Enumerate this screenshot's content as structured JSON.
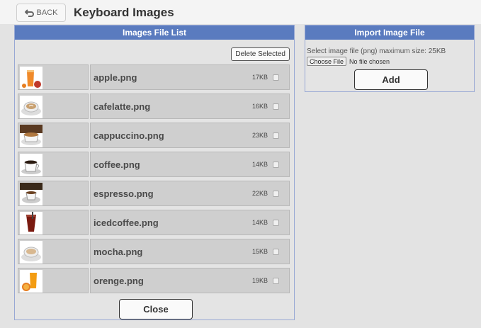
{
  "header": {
    "back_label": "BACK",
    "title": "Keyboard Images"
  },
  "list_panel": {
    "title": "Images File List",
    "delete_selected_label": "Delete Selected",
    "close_label": "Close",
    "files": [
      {
        "name": "apple.png",
        "size": "17KB",
        "icon": "orange-juice-glass-icon"
      },
      {
        "name": "cafelatte.png",
        "size": "16KB",
        "icon": "latte-cup-icon"
      },
      {
        "name": "cappuccino.png",
        "size": "23KB",
        "icon": "cappuccino-cup-icon"
      },
      {
        "name": "coffee.png",
        "size": "14KB",
        "icon": "coffee-cup-icon"
      },
      {
        "name": "espresso.png",
        "size": "22KB",
        "icon": "espresso-cup-icon"
      },
      {
        "name": "icedcoffee.png",
        "size": "14KB",
        "icon": "iced-coffee-glass-icon"
      },
      {
        "name": "mocha.png",
        "size": "15KB",
        "icon": "mocha-cup-icon"
      },
      {
        "name": "orenge.png",
        "size": "19KB",
        "icon": "orange-juice-icon"
      }
    ]
  },
  "import_panel": {
    "title": "Import Image File",
    "instruction": "Select image file (png) maximum size: 25KB",
    "choose_file_label": "Choose File",
    "no_file_text": "No file chosen",
    "add_label": "Add"
  },
  "colors": {
    "header_blue": "#5a7bbf",
    "panel_border": "#98a8d4"
  }
}
